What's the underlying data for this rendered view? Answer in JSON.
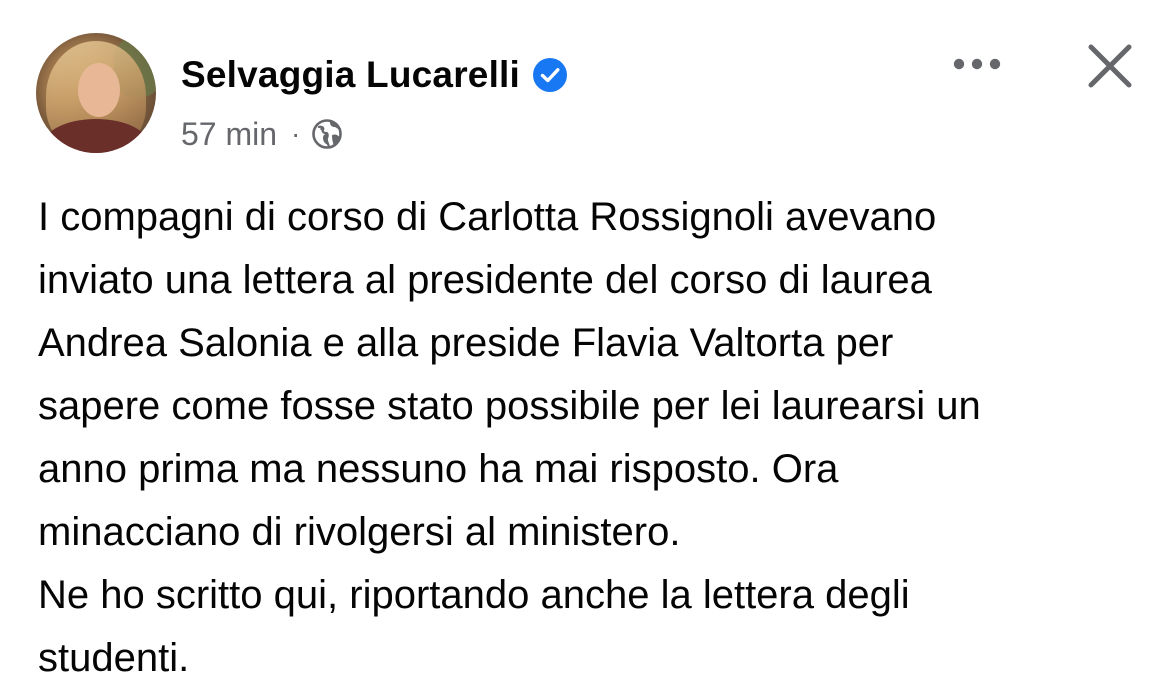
{
  "post": {
    "author": {
      "name": "Selvaggia Lucarelli",
      "verified_icon": "verified-badge-icon"
    },
    "meta": {
      "time": "57 min",
      "separator": "·",
      "audience_icon": "globe-icon"
    },
    "actions": {
      "more_icon": "more-options-icon",
      "close_icon": "close-icon"
    },
    "text": {
      "paragraph_1": "I compagni di corso di Carlotta Rossignoli avevano\ninviato una lettera al presidente del corso di laurea\nAndrea Salonia e alla preside Flavia Valtorta per\nsapere come fosse stato possibile per lei laurearsi un\nanno prima ma nessuno ha mai risposto. Ora\nminacciano di rivolgersi al ministero.",
      "paragraph_2": "Ne ho scritto qui, riportando anche la lettera degli\nstudenti."
    }
  },
  "colors": {
    "text_primary": "#050505",
    "text_secondary": "#65676b",
    "verified_blue": "#1877f2",
    "icon_gray": "#65676b",
    "background": "#ffffff"
  }
}
